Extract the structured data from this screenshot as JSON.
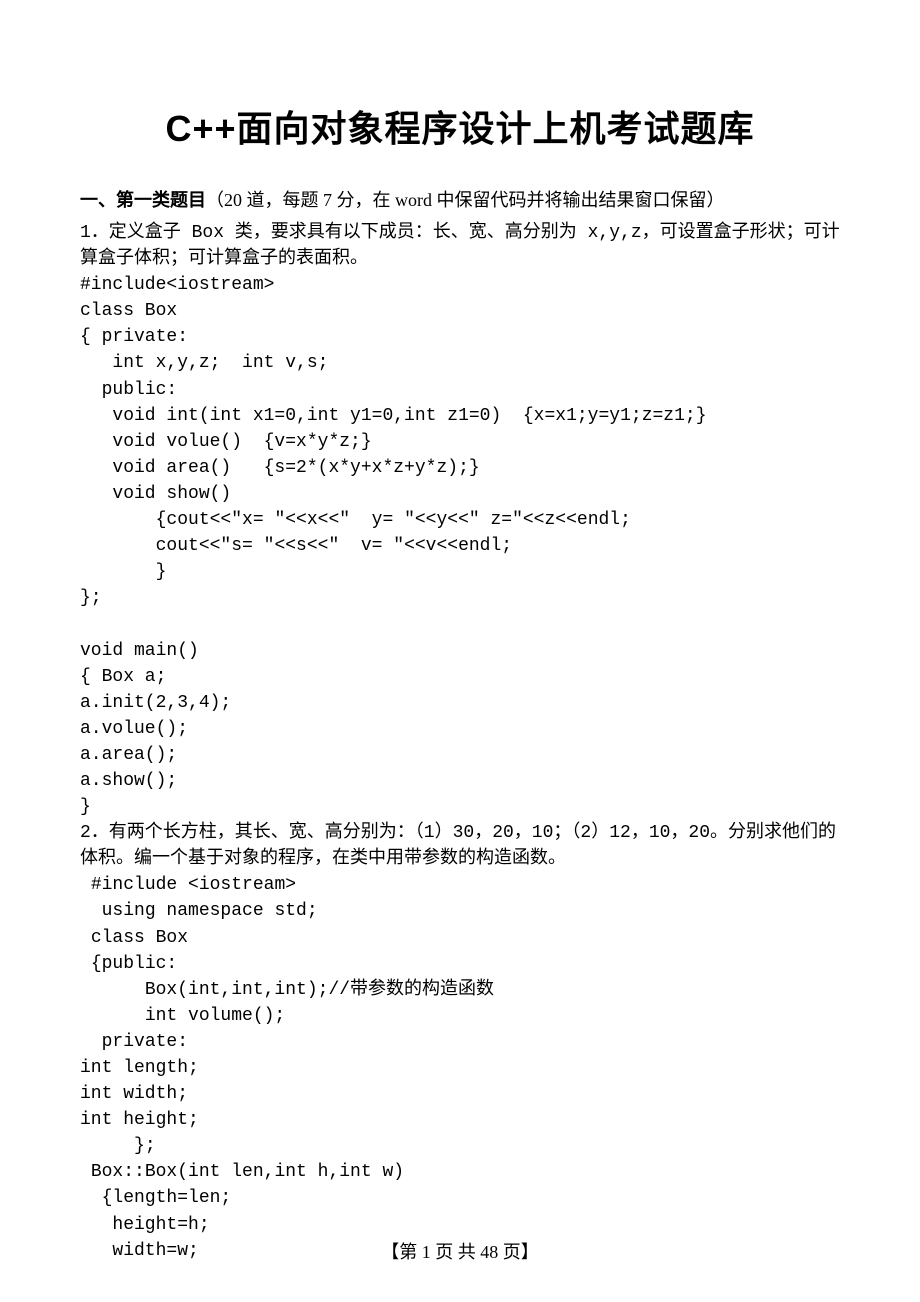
{
  "title": "C++面向对象程序设计上机考试题库",
  "section": {
    "label": "一、第一类题目",
    "note": "（20 道，每题 7 分，在 word 中保留代码并将输出结果窗口保留）"
  },
  "q1": {
    "prompt": "1．定义盒子 Box 类，要求具有以下成员：长、宽、高分别为 x,y,z，可设置盒子形状；可计算盒子体积；可计算盒子的表面积。",
    "code": "#include<iostream>\nclass Box\n{ private:\n   int x,y,z;  int v,s;\n  public:\n   void int(int x1=0,int y1=0,int z1=0)  {x=x1;y=y1;z=z1;}\n   void volue()  {v=x*y*z;}\n   void area()   {s=2*(x*y+x*z+y*z);}\n   void show()\n       {cout<<\"x= \"<<x<<\"  y= \"<<y<<\" z=\"<<z<<endl;\n       cout<<\"s= \"<<s<<\"  v= \"<<v<<endl;\n       }\n};\n\nvoid main()\n{ Box a;\na.init(2,3,4);\na.volue();\na.area();\na.show();\n}"
  },
  "q2": {
    "prompt": "2．有两个长方柱，其长、宽、高分别为：（1）30，20，10；（2）12，10，20。分别求他们的体积。编一个基于对象的程序，在类中用带参数的构造函数。",
    "code": " #include <iostream>\n  using namespace std;\n class Box\n {public:\n      Box(int,int,int);//带参数的构造函数\n      int volume();\n  private:\nint length;\nint width;\nint height;\n     };\n Box::Box(int len,int h,int w)\n  {length=len;\n   height=h;\n   width=w;"
  },
  "footer": "【第 1 页 共 48 页】"
}
